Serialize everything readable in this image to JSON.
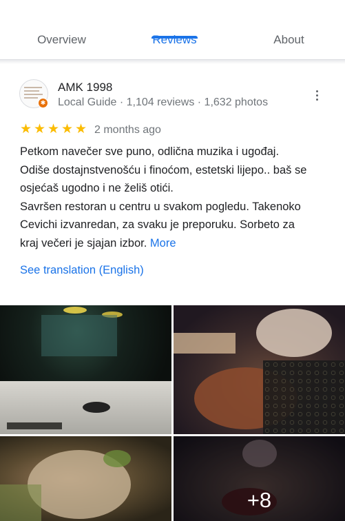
{
  "tabs": [
    {
      "label": "Overview",
      "active": false
    },
    {
      "label": "Reviews",
      "active": true
    },
    {
      "label": "About",
      "active": false
    }
  ],
  "review": {
    "author": "AMK 1998",
    "meta": "Local Guide · 1,104 reviews · 1,632 photos",
    "rating": 5,
    "time": "2 months ago",
    "lines": [
      "Petkom navečer sve puno, odlična muzika i ugođaj.",
      "Odiše dostajnstvenošću i finoćom, estetski lijepo.. baš se",
      "osjećaš ugodno i ne želiš otići.",
      "Savršen restoran u centru u svakom pogledu. Takenoko",
      "Cevichi izvanredan, za svaku je preporuku.  Sorbeto za",
      "kraj večeri  je sjajan izbor."
    ],
    "more_label": "More",
    "translate_label": "See translation (English)",
    "extra_photos": "+8"
  },
  "colors": {
    "accent": "#1a73e8",
    "star": "#fbbc04",
    "local_guide": "#e8710a"
  }
}
